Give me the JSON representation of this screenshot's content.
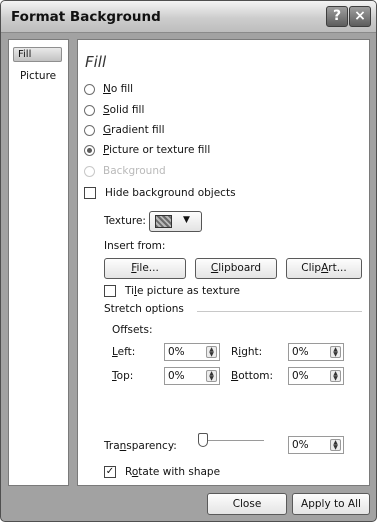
{
  "window": {
    "title": "Format Background",
    "help_label": "?",
    "close_label": "×"
  },
  "nav": {
    "items": [
      {
        "label": "Fill",
        "selected": true
      },
      {
        "label": "Picture",
        "selected": false
      }
    ]
  },
  "fill": {
    "heading": "Fill",
    "options": [
      {
        "label": "No fill",
        "accel": "N",
        "rest": "o fill",
        "checked": false,
        "enabled": true
      },
      {
        "label": "Solid fill",
        "accel": "S",
        "rest": "olid fill",
        "checked": false,
        "enabled": true
      },
      {
        "label": "Gradient fill",
        "accel": "G",
        "rest": "radient fill",
        "checked": false,
        "enabled": true
      },
      {
        "label": "Picture or texture fill",
        "accel": "P",
        "rest": "icture or texture fill",
        "checked": true,
        "enabled": true
      },
      {
        "label": "Background",
        "checked": false,
        "enabled": false
      }
    ],
    "hide_background": {
      "label": "Hide background objects",
      "checked": false
    },
    "texture_label": "Texture:",
    "insert_from_label": "Insert from:",
    "file_button": {
      "label": "File...",
      "accel": "F",
      "rest": "ile..."
    },
    "clipboard_button": {
      "label": "Clipboard",
      "accel": "C",
      "rest": "lipboard"
    },
    "clipart_button": {
      "label": "ClipArt...",
      "before": "Clip",
      "accel": "A",
      "rest": "rt..."
    },
    "tile_picture": {
      "label": "Tile picture as texture",
      "before": "Ti",
      "accel": "l",
      "rest": "e picture as texture",
      "checked": false
    },
    "stretch_options_label": "Stretch options",
    "offsets_label": "Offsets:",
    "left": {
      "label": "Left:",
      "accel": "L",
      "rest": "eft:",
      "value": "0%"
    },
    "right": {
      "label": "Right:",
      "before": "R",
      "accel": "i",
      "rest": "ght:",
      "value": "0%"
    },
    "top": {
      "label": "Top:",
      "accel": "T",
      "rest": "op:",
      "value": "0%"
    },
    "bottom": {
      "label": "Bottom:",
      "accel": "B",
      "rest": "ottom:",
      "value": "0%"
    },
    "transparency": {
      "label": "Transparency:",
      "before": "Tra",
      "accel": "n",
      "rest": "sparency:",
      "value": "0%",
      "level": 0
    },
    "rotate_with_shape": {
      "label": "Rotate with shape",
      "before": "R",
      "accel": "o",
      "rest": "tate with shape",
      "checked": true
    }
  },
  "footer": {
    "close_label": "Close",
    "apply_all_label": "Apply to All"
  }
}
